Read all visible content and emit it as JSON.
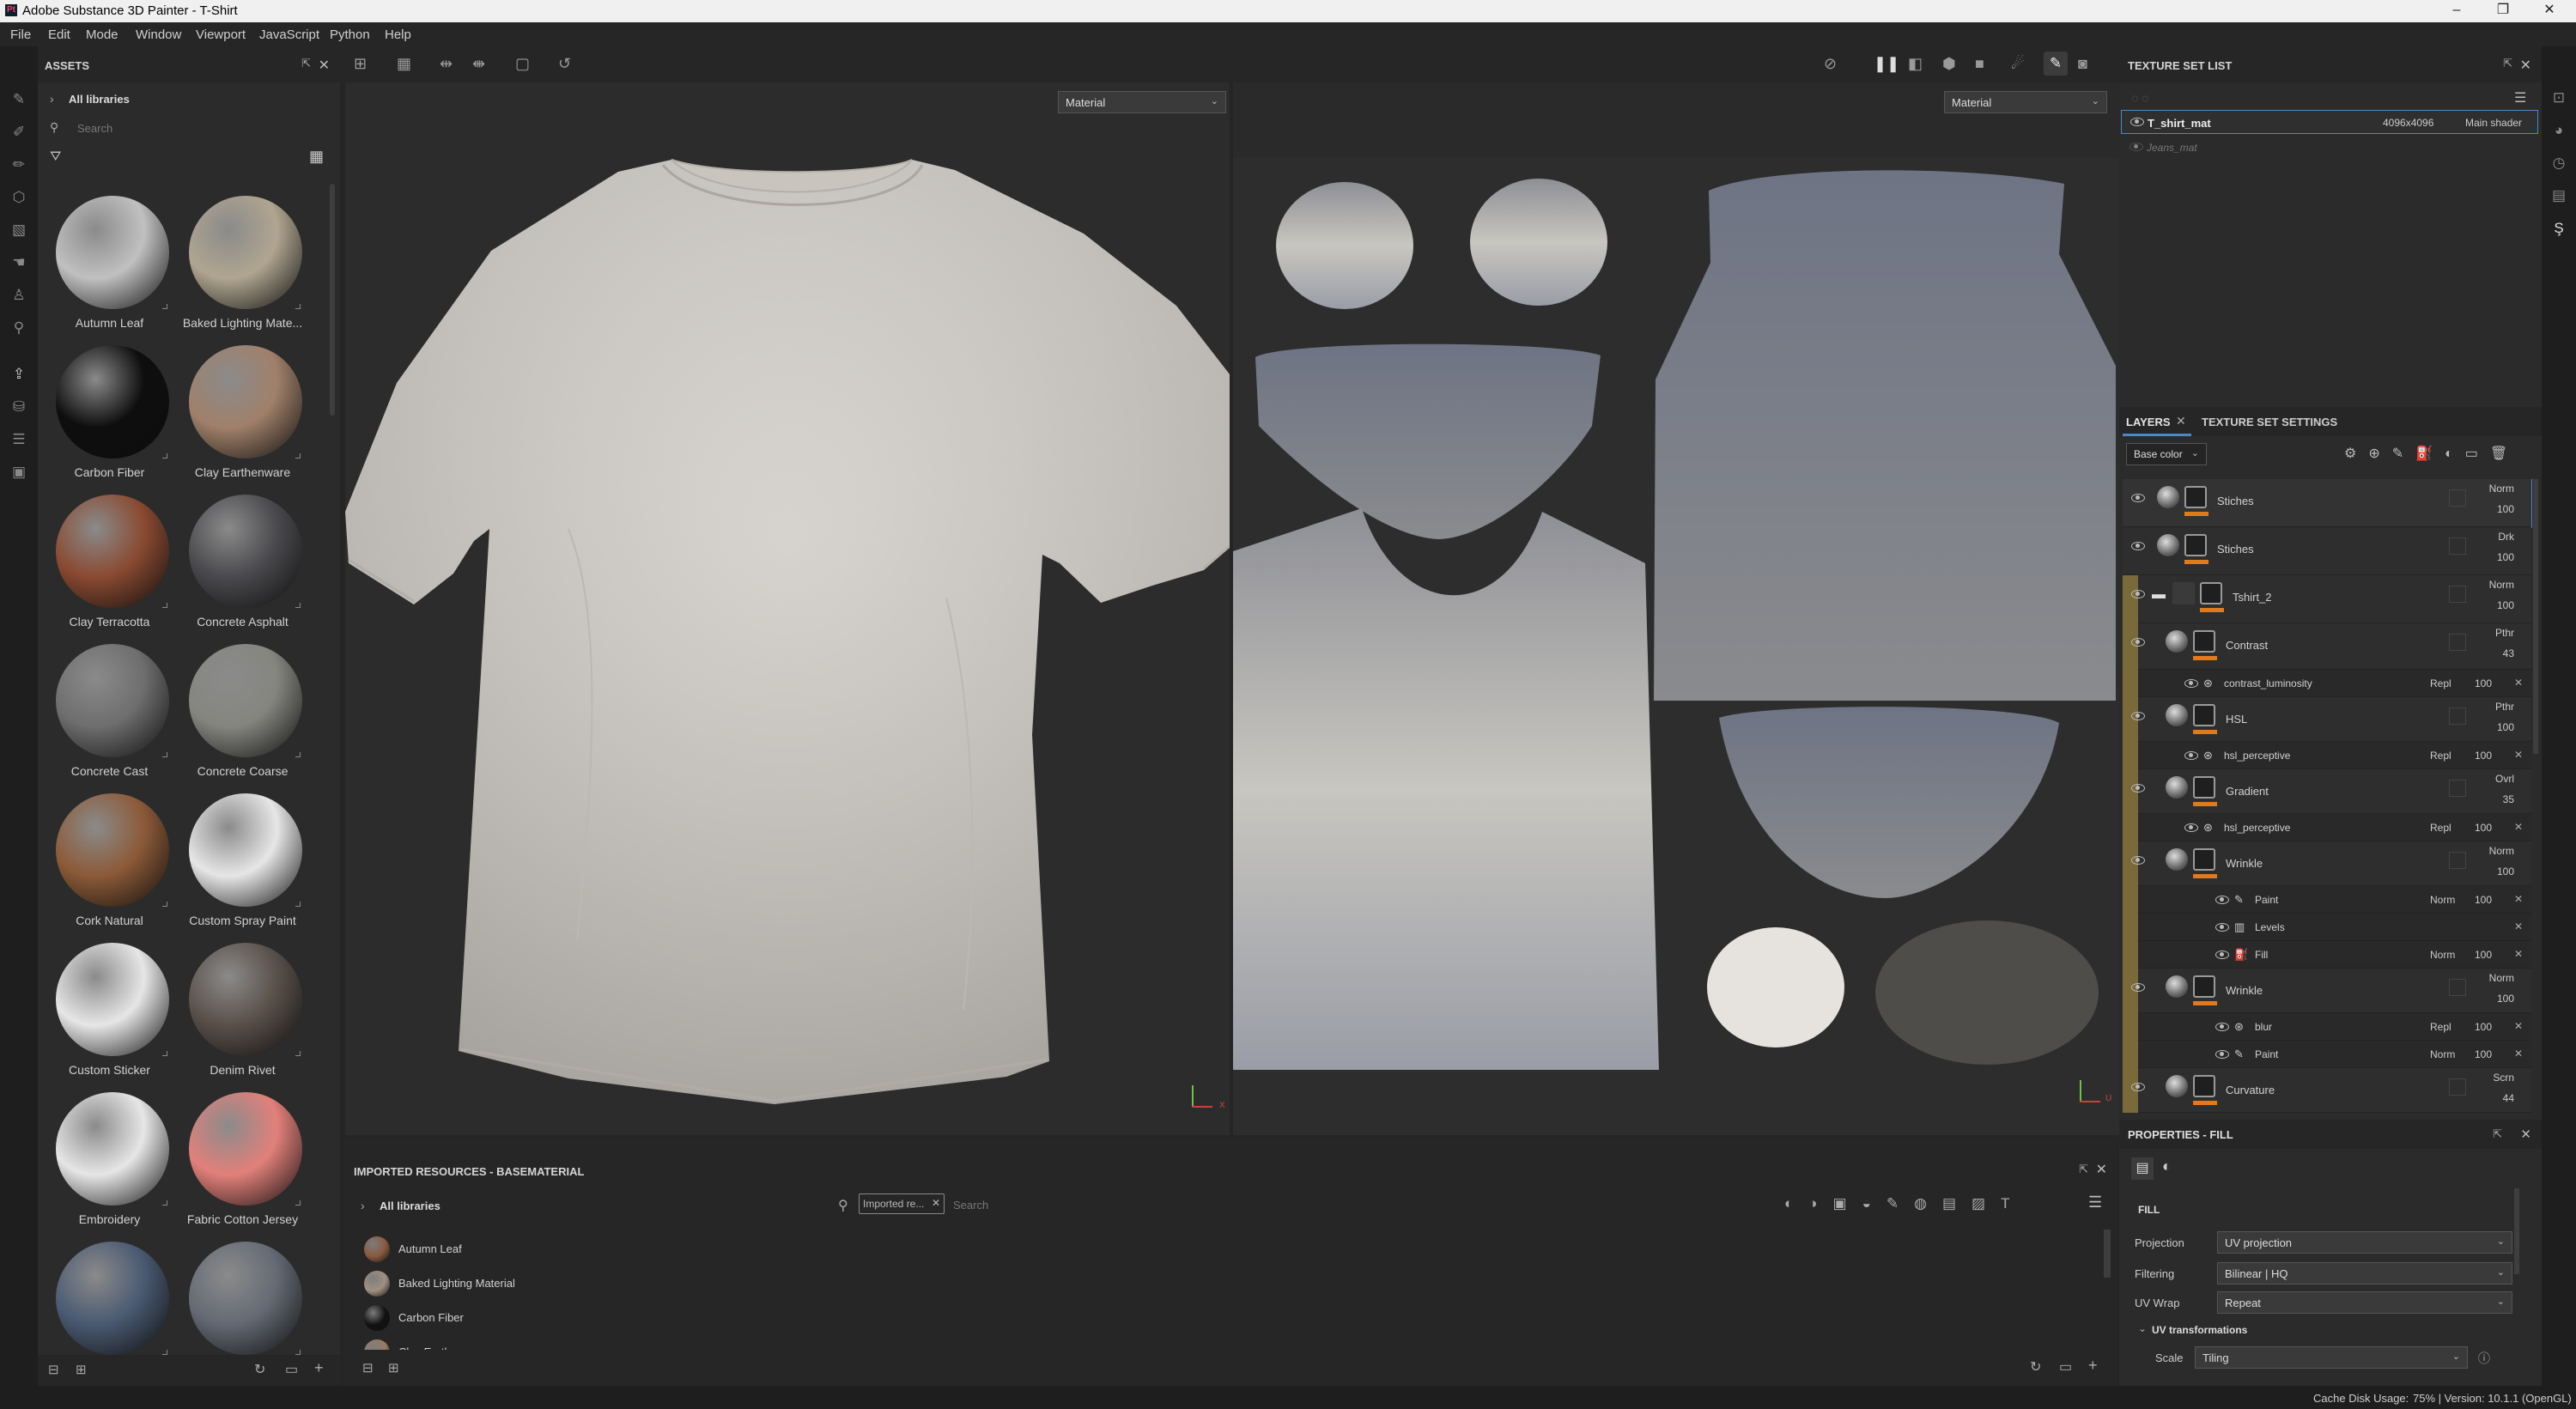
{
  "window": {
    "title": "Adobe Substance 3D Painter - T-Shirt",
    "logo": "Pt"
  },
  "menu": [
    "File",
    "Edit",
    "Mode",
    "Window",
    "Viewport",
    "JavaScript",
    "Python",
    "Help"
  ],
  "assets": {
    "title": "ASSETS",
    "library": "All libraries",
    "search_placeholder": "Search",
    "items": [
      {
        "name": "Autumn Leaf",
        "color": "#c0c0c0"
      },
      {
        "name": "Baked Lighting Mate...",
        "color": "#b0a590"
      },
      {
        "name": "Carbon Fiber",
        "color": "#0e0e0e"
      },
      {
        "name": "Clay Earthenware",
        "color": "#a0806a"
      },
      {
        "name": "Clay Terracotta",
        "color": "#8a4a32"
      },
      {
        "name": "Concrete Asphalt",
        "color": "#4a4a4e"
      },
      {
        "name": "Concrete Cast",
        "color": "#6e6e6e"
      },
      {
        "name": "Concrete Coarse",
        "color": "#858580"
      },
      {
        "name": "Cork Natural",
        "color": "#8c5a38"
      },
      {
        "name": "Custom Spray Paint",
        "color": "#e6e6e6"
      },
      {
        "name": "Custom Sticker",
        "color": "#e6e6e6"
      },
      {
        "name": "Denim Rivet",
        "color": "#5a504a"
      },
      {
        "name": "Embroidery",
        "color": "#e6e6e6"
      },
      {
        "name": "Fabric Cotton Jersey",
        "color": "#e2807a"
      },
      {
        "name": "",
        "color": "#4a5a72"
      },
      {
        "name": "",
        "color": "#646a74"
      }
    ]
  },
  "viewport": {
    "left_mode": "Material",
    "right_mode": "Material",
    "axis_x": "X",
    "axis_u": "U"
  },
  "imported": {
    "title": "IMPORTED RESOURCES - BASEMATERIAL",
    "library": "All libraries",
    "filter_tag": "Imported re...",
    "search_placeholder": "Search",
    "items": [
      {
        "name": "Autumn Leaf",
        "color": "#8a5a40"
      },
      {
        "name": "Baked Lighting Material",
        "color": "#a09080"
      },
      {
        "name": "Carbon Fiber",
        "color": "#111111"
      },
      {
        "name": "Clay Earthenware",
        "color": "#9a7a64"
      }
    ]
  },
  "texture_set_list": {
    "title": "TEXTURE SET LIST",
    "sets": [
      {
        "name": "T_shirt_mat",
        "resolution": "4096x4096",
        "shader": "Main shader"
      },
      {
        "name": "Jeans_mat",
        "resolution": "",
        "shader": ""
      }
    ]
  },
  "layers_panel": {
    "tab_layers": "LAYERS",
    "tab_settings": "TEXTURE SET SETTINGS",
    "channel": "Base color",
    "layers": [
      {
        "name": "Stiches",
        "blend": "Norm",
        "opacity": "100",
        "indent": 0,
        "kind": "layer"
      },
      {
        "name": "Stiches",
        "blend": "Drk",
        "opacity": "100",
        "indent": 0,
        "kind": "layer"
      },
      {
        "name": "Tshirt_2",
        "blend": "Norm",
        "opacity": "100",
        "indent": 0,
        "kind": "folder"
      },
      {
        "name": "Contrast",
        "blend": "Pthr",
        "opacity": "43",
        "indent": 1,
        "kind": "layer"
      },
      {
        "name": "contrast_luminosity",
        "blend": "Repl",
        "opacity": "100",
        "indent": 2,
        "kind": "effect"
      },
      {
        "name": "HSL",
        "blend": "Pthr",
        "opacity": "100",
        "indent": 1,
        "kind": "layer"
      },
      {
        "name": "hsl_perceptive",
        "blend": "Repl",
        "opacity": "100",
        "indent": 2,
        "kind": "effect"
      },
      {
        "name": "Gradient",
        "blend": "Ovrl",
        "opacity": "35",
        "indent": 1,
        "kind": "layer"
      },
      {
        "name": "hsl_perceptive",
        "blend": "Repl",
        "opacity": "100",
        "indent": 2,
        "kind": "effect"
      },
      {
        "name": "Wrinkle",
        "blend": "Norm",
        "opacity": "100",
        "indent": 1,
        "kind": "layer"
      },
      {
        "name": "Paint",
        "blend": "Norm",
        "opacity": "100",
        "indent": 3,
        "kind": "effect"
      },
      {
        "name": "Levels",
        "blend": "",
        "opacity": "",
        "indent": 3,
        "kind": "effect"
      },
      {
        "name": "Fill",
        "blend": "Norm",
        "opacity": "100",
        "indent": 3,
        "kind": "effect"
      },
      {
        "name": "Wrinkle",
        "blend": "Norm",
        "opacity": "100",
        "indent": 1,
        "kind": "layer"
      },
      {
        "name": "blur",
        "blend": "Repl",
        "opacity": "100",
        "indent": 3,
        "kind": "effect"
      },
      {
        "name": "Paint",
        "blend": "Norm",
        "opacity": "100",
        "indent": 3,
        "kind": "effect"
      },
      {
        "name": "Curvature",
        "blend": "Scrn",
        "opacity": "44",
        "indent": 1,
        "kind": "layer"
      }
    ]
  },
  "properties": {
    "title": "PROPERTIES - FILL",
    "section": "FILL",
    "rows": [
      {
        "label": "Projection",
        "value": "UV projection"
      },
      {
        "label": "Filtering",
        "value": "Bilinear | HQ"
      },
      {
        "label": "UV Wrap",
        "value": "Repeat"
      }
    ],
    "subsection": "UV transformations",
    "scale_label": "Scale",
    "scale_value": "Tiling"
  },
  "status": {
    "cache": "Cache Disk Usage:",
    "info": "75% | Version: 10.1.1 (OpenGL)"
  },
  "colors": {
    "accent": "#e07a1a",
    "selection": "#4a88c7",
    "folder_band": "#7a6a3a"
  }
}
